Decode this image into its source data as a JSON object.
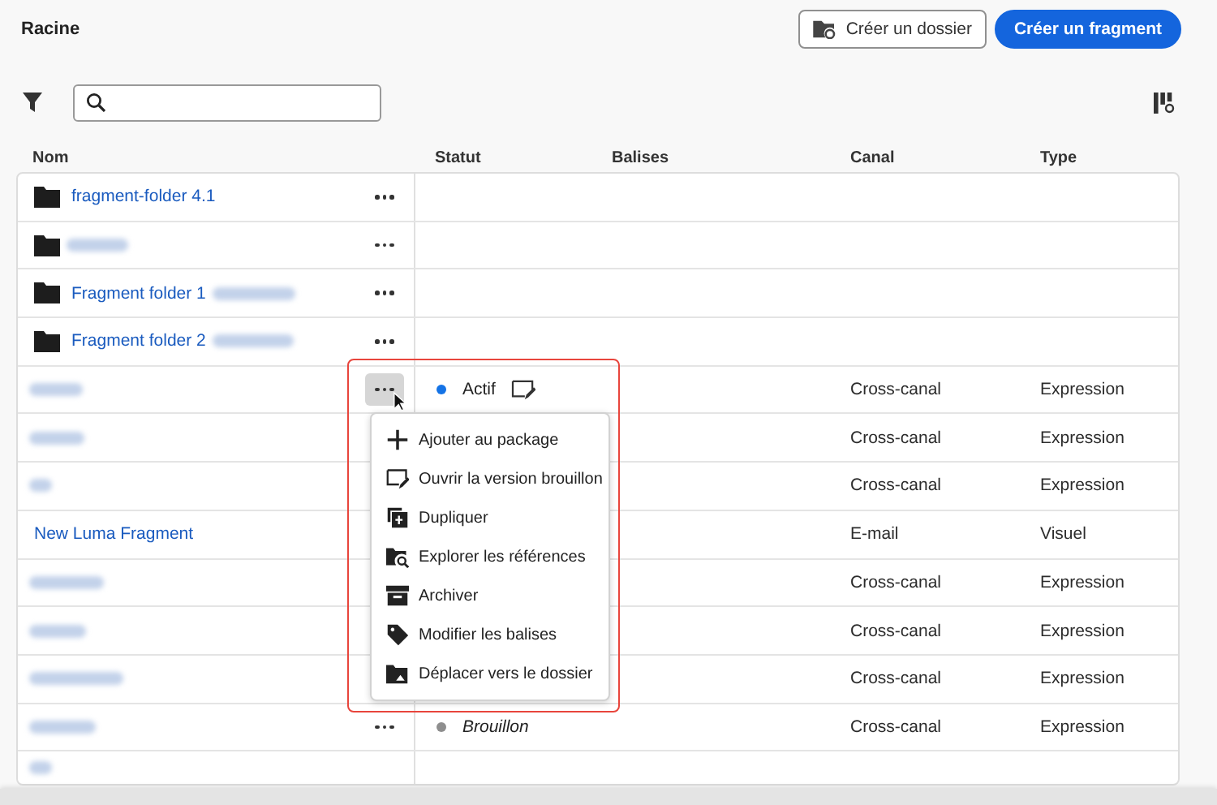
{
  "title": "Racine",
  "buttons": [
    {
      "kind": "secondary",
      "label": "Créer un dossier"
    },
    {
      "kind": "primary",
      "label": "Créer un fragment"
    }
  ],
  "columns": [
    "Nom",
    "Statut",
    "Balises",
    "Canal",
    "Type"
  ],
  "rows": [
    {
      "kind": "folder",
      "name": "fragment-folder 4.1",
      "blurred": false,
      "more": true,
      "more_active": false
    },
    {
      "kind": "folder",
      "name": "",
      "blurred": true,
      "more": true,
      "more_active": false
    },
    {
      "kind": "folder",
      "name": "Fragment folder 1",
      "blurred": true,
      "more": true,
      "more_active": false
    },
    {
      "kind": "folder",
      "name": "Fragment folder 2",
      "blurred": true,
      "more": true,
      "more_active": false
    },
    {
      "kind": "fragment",
      "name": "",
      "blurred": true,
      "more": true,
      "more_active": true,
      "status": {
        "label": "Actif",
        "color": "#1473e6",
        "italic": false,
        "draft_icon": true
      },
      "canal": "Cross-canal",
      "type": "Expression"
    },
    {
      "kind": "fragment",
      "name": "",
      "blurred": true,
      "more": false,
      "canal": "Cross-canal",
      "type": "Expression"
    },
    {
      "kind": "fragment",
      "name": "",
      "blurred": true,
      "more": false,
      "canal": "Cross-canal",
      "type": "Expression"
    },
    {
      "kind": "fragment",
      "name": "New Luma Fragment",
      "blurred": false,
      "more": false,
      "canal": "E-mail",
      "type": "Visuel"
    },
    {
      "kind": "fragment",
      "name": "",
      "blurred": true,
      "more": false,
      "canal": "Cross-canal",
      "type": "Expression"
    },
    {
      "kind": "fragment",
      "name": "",
      "blurred": true,
      "more": false,
      "canal": "Cross-canal",
      "type": "Expression"
    },
    {
      "kind": "fragment",
      "name": "",
      "blurred": true,
      "more": false,
      "canal": "Cross-canal",
      "type": "Expression"
    },
    {
      "kind": "fragment",
      "name": "",
      "blurred": true,
      "more": true,
      "more_active": false,
      "status": {
        "label": "Brouillon",
        "color": "#8e8e8e",
        "italic": true,
        "draft_icon": false
      },
      "canal": "Cross-canal",
      "type": "Expression"
    }
  ],
  "menu": {
    "items": [
      {
        "kind": "add",
        "label": "Ajouter au package"
      },
      {
        "kind": "draft",
        "label": "Ouvrir la version brouillon"
      },
      {
        "kind": "duplicate",
        "label": "Dupliquer"
      },
      {
        "kind": "references",
        "label": "Explorer les références"
      },
      {
        "kind": "archive",
        "label": "Archiver"
      },
      {
        "kind": "tag",
        "label": "Modifier les balises"
      },
      {
        "kind": "move",
        "label": "Déplacer vers le dossier"
      }
    ]
  }
}
